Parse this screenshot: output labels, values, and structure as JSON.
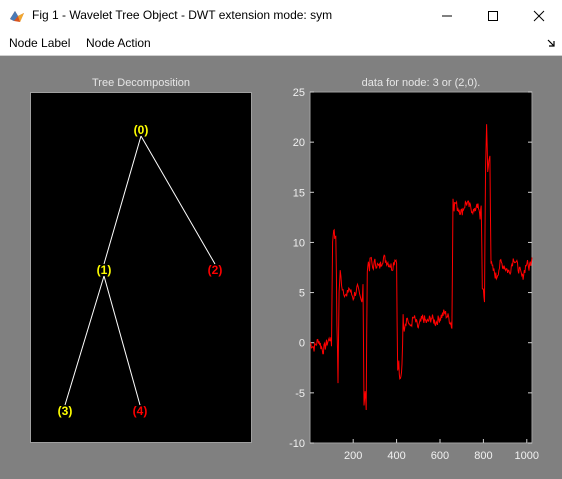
{
  "window": {
    "title": "Fig 1 - Wavelet Tree Object - DWT extension mode: sym",
    "minimize_icon": "minimize-icon",
    "maximize_icon": "maximize-icon",
    "close_icon": "close-icon"
  },
  "menu": {
    "items": [
      "Node Label",
      "Node Action"
    ],
    "dock_icon": "dock-arrow-icon"
  },
  "tree_panel": {
    "title": "Tree Decomposition",
    "nodes": [
      {
        "label": "(0)",
        "color": "#ffff00"
      },
      {
        "label": "(1)",
        "color": "#ffff00"
      },
      {
        "label": "(2)",
        "color": "#ff0000"
      },
      {
        "label": "(3)",
        "color": "#ffff00"
      },
      {
        "label": "(4)",
        "color": "#ff0000"
      }
    ],
    "edges": [
      [
        "(0)",
        "(1)"
      ],
      [
        "(0)",
        "(2)"
      ],
      [
        "(1)",
        "(3)"
      ],
      [
        "(1)",
        "(4)"
      ]
    ],
    "edge_color": "#ffffff"
  },
  "chart_data": {
    "type": "line",
    "title": "data for node: 3 or (2,0).",
    "xlabel": "",
    "ylabel": "",
    "xlim": [
      1,
      1024
    ],
    "ylim": [
      -10,
      25
    ],
    "x_ticks": [
      "200",
      "400",
      "600",
      "800",
      "1000"
    ],
    "y_ticks": [
      "25",
      "20",
      "15",
      "10",
      "5",
      "0",
      "-5",
      "-10"
    ],
    "series": [
      {
        "color": "#ff0000",
        "x": [
          1,
          20,
          40,
          60,
          80,
          95,
          100,
          105,
          110,
          115,
          120,
          125,
          130,
          135,
          140,
          150,
          160,
          170,
          180,
          190,
          200,
          210,
          220,
          230,
          240,
          245,
          250,
          255,
          260,
          265,
          270,
          275,
          280,
          290,
          300,
          320,
          340,
          360,
          380,
          395,
          400,
          405,
          410,
          415,
          420,
          425,
          430,
          435,
          440,
          450,
          460,
          470,
          480,
          500,
          520,
          540,
          560,
          580,
          600,
          620,
          640,
          650,
          655,
          660,
          665,
          670,
          680,
          700,
          720,
          740,
          760,
          770,
          775,
          780,
          785,
          790,
          795,
          800,
          805,
          810,
          815,
          820,
          825,
          830,
          835,
          840,
          860,
          880,
          900,
          920,
          940,
          960,
          980,
          1000,
          1010,
          1024
        ],
        "y": [
          0,
          -0.5,
          0.3,
          -0.8,
          0,
          0.5,
          -0.3,
          10,
          11.5,
          10.5,
          11,
          2,
          -4,
          5,
          7,
          5.5,
          5,
          4.5,
          5.5,
          5,
          4.5,
          5,
          5.5,
          4.5,
          4,
          6,
          -6,
          -5,
          -6.5,
          7.5,
          8,
          7.5,
          8.5,
          7.5,
          8,
          7.5,
          8.5,
          8,
          7.5,
          8.5,
          8,
          -3,
          -2,
          -4,
          -3.5,
          -2,
          2.5,
          1.5,
          2,
          2.5,
          1.5,
          2,
          2.5,
          1.5,
          2.5,
          2,
          2.5,
          2,
          2.5,
          3,
          2.5,
          2,
          1.5,
          14.5,
          13.5,
          14,
          13.5,
          13,
          14,
          13.5,
          13,
          14,
          13.5,
          13,
          12.5,
          14,
          5,
          5.5,
          4,
          18,
          21.5,
          17,
          18,
          19,
          8,
          7.5,
          6.5,
          8,
          7.5,
          7,
          8.5,
          7.5,
          6.5,
          8,
          7.5,
          8.5
        ]
      }
    ],
    "grid": false,
    "background": "#000000"
  }
}
